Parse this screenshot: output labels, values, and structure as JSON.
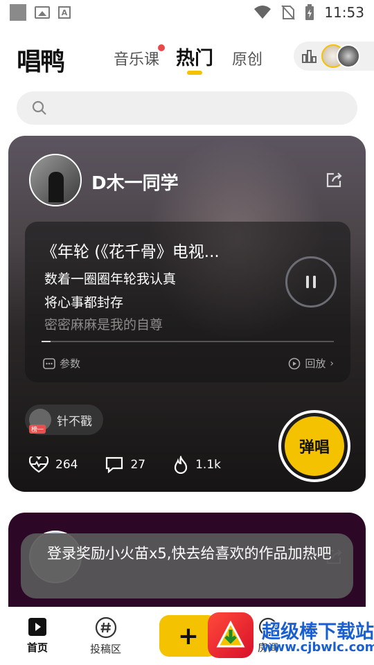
{
  "status_bar": {
    "time": "11:53",
    "a_label": "A"
  },
  "header": {
    "logo": "唱鸭",
    "tabs": [
      {
        "label": "音乐课",
        "has_dot": true
      },
      {
        "label": "热门",
        "active": true
      },
      {
        "label": "原创"
      }
    ]
  },
  "feed_card": {
    "user_name": "D木一同学",
    "song_title": "《年轮 (《花千骨》电视...",
    "lyrics": [
      "数着一圈圈年轮我认真",
      "将心事都封存",
      "密密麻麻是我的自尊"
    ],
    "progress": 0.03,
    "param_label": "参数",
    "replay_label": "回放",
    "chip": {
      "name": "针不戳",
      "tag": "榜一"
    },
    "sing_label": "弹唱",
    "stats": {
      "likes": "264",
      "comments": "27",
      "heat": "1.1k"
    }
  },
  "toast": "登录奖励小火苗x5,快去给喜欢的作品加热吧",
  "bottom_nav": {
    "items": [
      {
        "label": "首页",
        "active": true
      },
      {
        "label": "投稿区"
      },
      {
        "label": "房间"
      }
    ],
    "add_label": "+"
  },
  "watermark": {
    "title": "超级棒下载站",
    "url": "www.cjbwlc.com"
  },
  "colors": {
    "accent": "#f5c200",
    "dot": "#e84a4a",
    "card_bg": "#1e1b1c"
  }
}
